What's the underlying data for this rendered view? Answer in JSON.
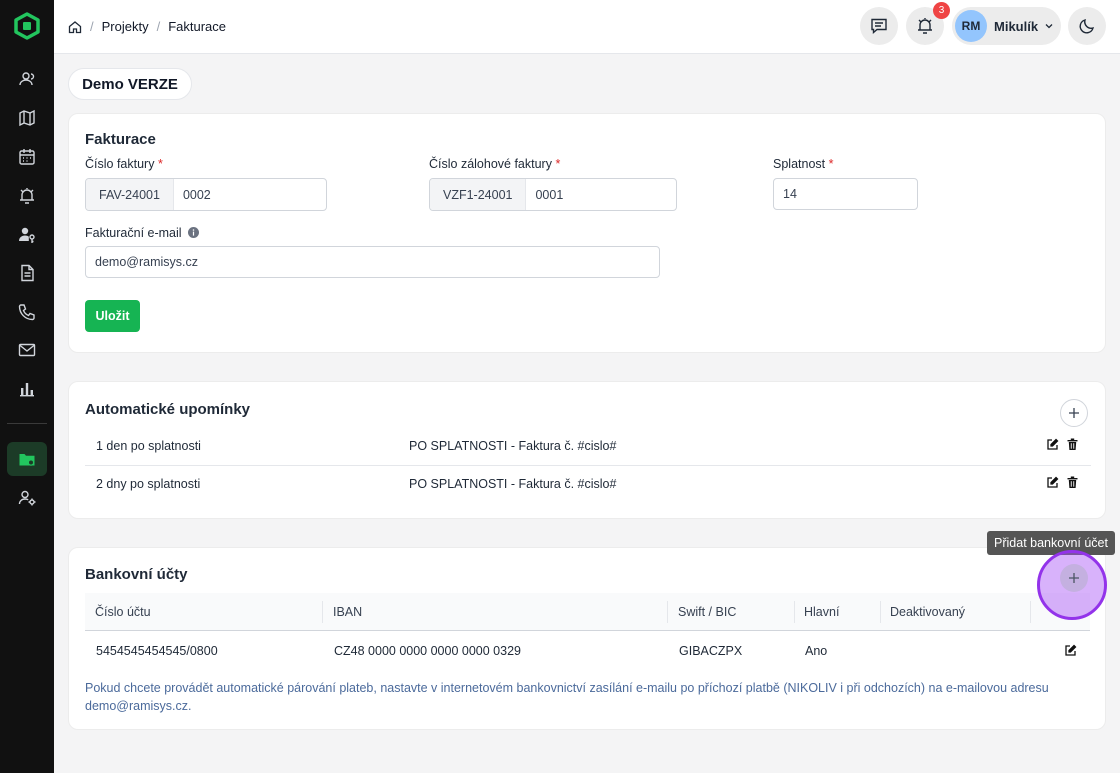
{
  "breadcrumb": {
    "items": [
      "Projekty",
      "Fakturace"
    ]
  },
  "header": {
    "notifications_count": "3",
    "user_initials": "RM",
    "user_name": "Mikulík"
  },
  "page": {
    "badge": "Demo VERZE"
  },
  "invoicing": {
    "title": "Fakturace",
    "invoice_number_label": "Číslo faktury",
    "invoice_prefix": "FAV-24001",
    "invoice_number": "0002",
    "deposit_label": "Číslo zálohové faktury",
    "deposit_prefix": "VZF1-24001",
    "deposit_number": "0001",
    "due_label": "Splatnost",
    "due_value": "14",
    "email_label": "Fakturační e-mail",
    "email_value": "demo@ramisys.cz",
    "save_label": "Uložit",
    "required_mark": "*"
  },
  "reminders": {
    "title": "Automatické upomínky",
    "rows": [
      {
        "when": "1 den po splatnosti",
        "template": "PO SPLATNOSTI - Faktura č. #cislo#"
      },
      {
        "when": "2 dny po splatnosti",
        "template": "PO SPLATNOSTI - Faktura č. #cislo#"
      }
    ]
  },
  "bank": {
    "title": "Bankovní účty",
    "columns": [
      "Číslo účtu",
      "IBAN",
      "Swift / BIC",
      "Hlavní",
      "Deaktivovaný"
    ],
    "rows": [
      {
        "account": "5454545454545/0800",
        "iban": "CZ48 0000 0000 0000 0000 0329",
        "swift": "GIBACZPX",
        "main": "Ano",
        "deactivated": ""
      }
    ],
    "note": "Pokud chcete provádět automatické párování plateb, nastavte v internetovém bankovnictví zasílání e-mailu po příchozí platbě (NIKOLIV i při odchozích) na e-mailovou adresu demo@ramisys.cz.",
    "add_tooltip": "Přidat bankovní účet"
  },
  "colors": {
    "accent": "#16b453",
    "highlight": "#9333ea"
  },
  "sidebar": {
    "icons": [
      "users-icon",
      "map-icon",
      "calendar-icon",
      "alarm-icon",
      "user-key-icon",
      "document-icon",
      "phone-icon",
      "mail-icon",
      "chart-icon",
      "folder-settings-icon",
      "user-settings-icon"
    ]
  }
}
